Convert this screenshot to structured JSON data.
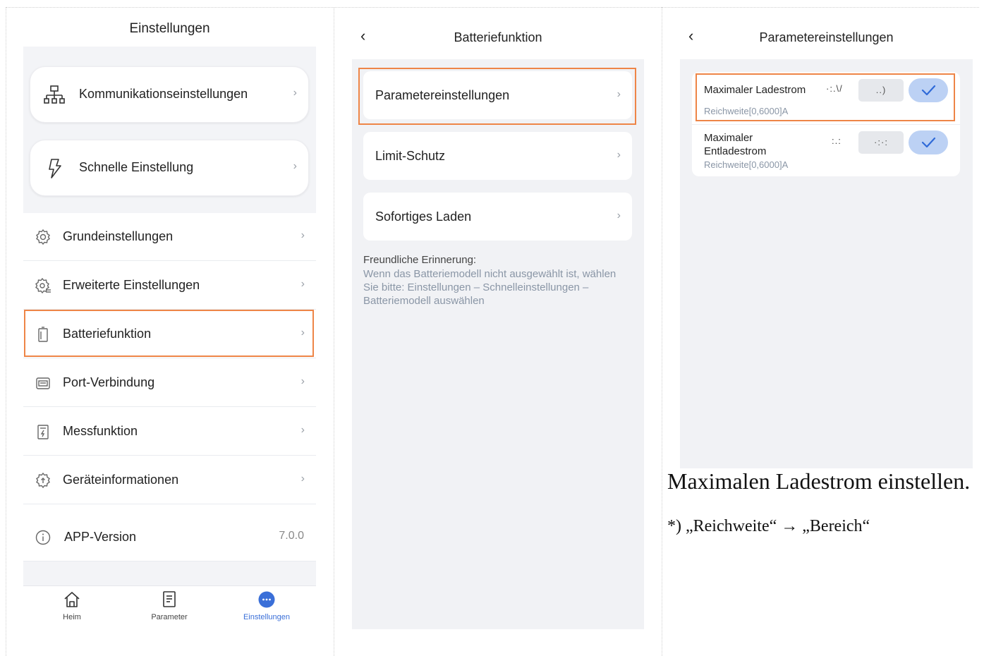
{
  "panel1": {
    "title": "Einstellungen",
    "cards": [
      {
        "label": "Kommunikationseinstellungen",
        "icon": "network-icon"
      },
      {
        "label": "Schnelle Einstellung",
        "icon": "lightning-icon"
      }
    ],
    "rows": [
      {
        "label": "Grundeinstellungen",
        "icon": "gear-icon"
      },
      {
        "label": "Erweiterte Einstellungen",
        "icon": "advanced-gear-icon"
      },
      {
        "label": "Batteriefunktion",
        "icon": "battery-icon"
      },
      {
        "label": "Port-Verbindung",
        "icon": "port-icon"
      },
      {
        "label": "Messfunktion",
        "icon": "meter-icon"
      },
      {
        "label": "Geräteinformationen",
        "icon": "device-info-icon"
      }
    ],
    "app_version": {
      "label": "APP-Version",
      "value": "7.0.0",
      "icon": "info-icon"
    },
    "tabs": [
      {
        "label": "Heim",
        "icon": "home-icon"
      },
      {
        "label": "Parameter",
        "icon": "document-icon"
      },
      {
        "label": "Einstellungen",
        "icon": "more-icon",
        "active": true
      }
    ]
  },
  "panel2": {
    "title": "Batteriefunktion",
    "items": [
      {
        "label": "Parametereinstellungen"
      },
      {
        "label": "Limit-Schutz"
      },
      {
        "label": "Sofortiges Laden"
      }
    ],
    "note_title": "Freundliche Erinnerung:",
    "note_text": "Wenn das Batteriemodell nicht ausgewählt ist, wählen Sie bitte: Einstellungen – Schnelleinstellungen – Batteriemodell auswählen"
  },
  "panel3": {
    "title": "Parametereinstellungen",
    "params": [
      {
        "name": "Maximaler Ladestrom",
        "range": "Reichweite[0,6000]A",
        "current": "·:.\\/",
        "input": "..)"
      },
      {
        "name": "Maximaler Entladestrom",
        "range": "Reichweite[0,6000]A",
        "current": ":.:",
        "input": "·:·:"
      }
    ]
  },
  "caption": "Maximalen Ladestrom einstellen.",
  "footnote": "*) „Reichweite“ → „Bereich“",
  "colors": {
    "highlight": "#ee8547",
    "accent": "#3a6fd8",
    "confirm_bg": "#bcd1f4",
    "background_gray": "#f1f2f5"
  }
}
